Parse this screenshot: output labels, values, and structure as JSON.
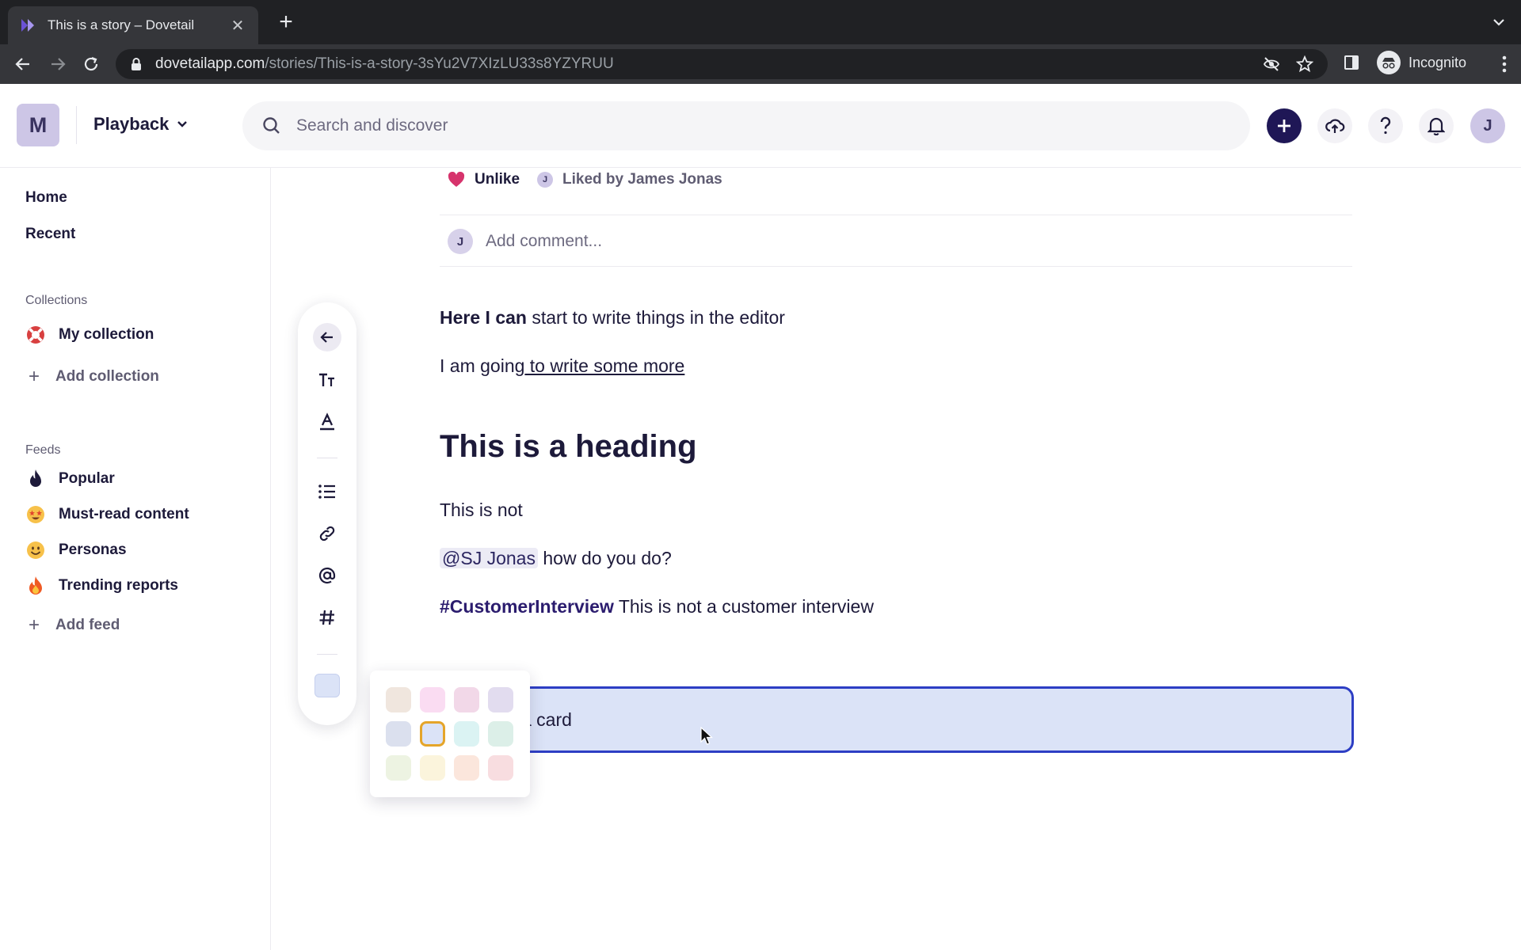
{
  "browser": {
    "tab_title": "This is a story – Dovetail",
    "url_host": "dovetailapp.com",
    "url_path": "/stories/This-is-a-story-3sYu2V7XIzLU33s8YZYRUU",
    "profile_label": "Incognito"
  },
  "header": {
    "workspace_initial": "M",
    "project_name": "Playback",
    "search_placeholder": "Search and discover",
    "user_initial": "J",
    "accent_color": "#1f1756"
  },
  "sidebar": {
    "home": "Home",
    "recent": "Recent",
    "collections_title": "Collections",
    "collections": [
      {
        "label": "My collection",
        "icon": "lifebuoy-icon"
      }
    ],
    "add_collection": "Add collection",
    "feeds_title": "Feeds",
    "feeds": [
      {
        "label": "Popular",
        "icon": "flame-icon"
      },
      {
        "label": "Must-read content",
        "icon": "star-struck-emoji-icon"
      },
      {
        "label": "Personas",
        "icon": "smile-emoji-icon"
      },
      {
        "label": "Trending reports",
        "icon": "fire-emoji-icon"
      }
    ],
    "add_feed": "Add feed"
  },
  "story": {
    "unlike_label": "Unlike",
    "liker_initial": "J",
    "liked_by": "Liked by James Jonas",
    "comment_initial": "J",
    "comment_placeholder": "Add comment...",
    "p1_bold": "Here I can",
    "p1_rest": " start to write things in the editor",
    "p2_plain": "I am going",
    "p2_link": " to write some more",
    "heading": "This is a heading",
    "p3": "This is not",
    "mention": "@SJ Jonas",
    "p4_rest": " how do you do?",
    "hashtag": "#CustomerInterview",
    "p5_rest": " This is not a customer interview",
    "card_text": "a card",
    "card_color": "#dbe3f7"
  },
  "format_toolbar": {
    "buttons": [
      "back-arrow-icon",
      "text-size-icon",
      "text-color-icon",
      "bullet-list-icon",
      "link-icon",
      "mention-icon",
      "hashtag-icon",
      "card-color-swatch"
    ]
  },
  "palette": {
    "colors": [
      "#f0e6de",
      "#fadcf2",
      "#f2d8e8",
      "#e2dcef",
      "#dbe0ee",
      "#dbe3f7",
      "#dbf3f3",
      "#dcefe8",
      "#edf3e2",
      "#fbf4dc",
      "#fbe6dc",
      "#f8dde0"
    ],
    "selected_index": 5,
    "selected_border": "#e5a52a"
  }
}
